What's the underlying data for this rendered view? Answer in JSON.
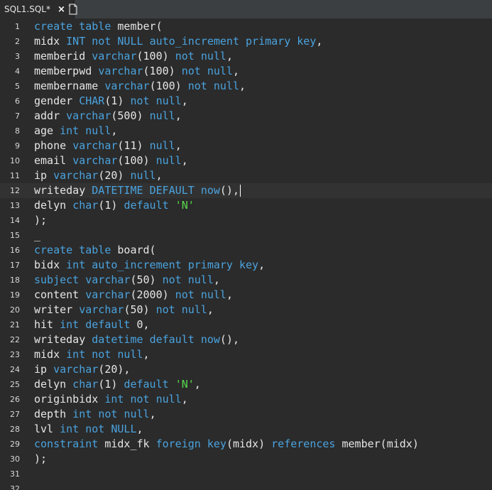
{
  "tab": {
    "title": "SQL1.SQL*",
    "close_symbol": "×"
  },
  "icons": {
    "new_tab": "new-document-icon"
  },
  "colors": {
    "background": "#2b2b2b",
    "keyword": "#4aa3df",
    "string": "#57d94a",
    "text": "#e6e6e6",
    "gutter": "#d8d8d8"
  },
  "editor": {
    "current_line": 12,
    "lines": [
      {
        "n": "1",
        "tokens": [
          [
            "k",
            "create"
          ],
          [
            "p",
            " "
          ],
          [
            "k",
            "table"
          ],
          [
            "p",
            " member("
          ]
        ]
      },
      {
        "n": "2",
        "tokens": [
          [
            "p",
            "midx "
          ],
          [
            "k",
            "INT"
          ],
          [
            "p",
            " "
          ],
          [
            "k",
            "not"
          ],
          [
            "p",
            " "
          ],
          [
            "k",
            "NULL"
          ],
          [
            "p",
            " "
          ],
          [
            "k",
            "auto_increment"
          ],
          [
            "p",
            " "
          ],
          [
            "k",
            "primary"
          ],
          [
            "p",
            " "
          ],
          [
            "k",
            "key"
          ],
          [
            "p",
            ","
          ]
        ]
      },
      {
        "n": "3",
        "tokens": [
          [
            "p",
            "memberid "
          ],
          [
            "k",
            "varchar"
          ],
          [
            "p",
            "(100) "
          ],
          [
            "k",
            "not"
          ],
          [
            "p",
            " "
          ],
          [
            "k",
            "null"
          ],
          [
            "p",
            ","
          ]
        ]
      },
      {
        "n": "4",
        "tokens": [
          [
            "p",
            "memberpwd "
          ],
          [
            "k",
            "varchar"
          ],
          [
            "p",
            "(100) "
          ],
          [
            "k",
            "not"
          ],
          [
            "p",
            " "
          ],
          [
            "k",
            "null"
          ],
          [
            "p",
            ","
          ]
        ]
      },
      {
        "n": "5",
        "tokens": [
          [
            "p",
            "membername "
          ],
          [
            "k",
            "varchar"
          ],
          [
            "p",
            "(100) "
          ],
          [
            "k",
            "not"
          ],
          [
            "p",
            " "
          ],
          [
            "k",
            "null"
          ],
          [
            "p",
            ","
          ]
        ]
      },
      {
        "n": "6",
        "tokens": [
          [
            "p",
            "gender "
          ],
          [
            "k",
            "CHAR"
          ],
          [
            "p",
            "(1) "
          ],
          [
            "k",
            "not"
          ],
          [
            "p",
            " "
          ],
          [
            "k",
            "null"
          ],
          [
            "p",
            ","
          ]
        ]
      },
      {
        "n": "7",
        "tokens": [
          [
            "p",
            "addr "
          ],
          [
            "k",
            "varchar"
          ],
          [
            "p",
            "(500) "
          ],
          [
            "k",
            "null"
          ],
          [
            "p",
            ","
          ]
        ]
      },
      {
        "n": "8",
        "tokens": [
          [
            "p",
            "age "
          ],
          [
            "k",
            "int"
          ],
          [
            "p",
            " "
          ],
          [
            "k",
            "null"
          ],
          [
            "p",
            ","
          ]
        ]
      },
      {
        "n": "9",
        "tokens": [
          [
            "p",
            "phone "
          ],
          [
            "k",
            "varchar"
          ],
          [
            "p",
            "(11) "
          ],
          [
            "k",
            "null"
          ],
          [
            "p",
            ","
          ]
        ]
      },
      {
        "n": "10",
        "tokens": [
          [
            "p",
            "email "
          ],
          [
            "k",
            "varchar"
          ],
          [
            "p",
            "(100) "
          ],
          [
            "k",
            "null"
          ],
          [
            "p",
            ","
          ]
        ]
      },
      {
        "n": "11",
        "tokens": [
          [
            "p",
            "ip "
          ],
          [
            "k",
            "varchar"
          ],
          [
            "p",
            "(20) "
          ],
          [
            "k",
            "null"
          ],
          [
            "p",
            ","
          ]
        ]
      },
      {
        "n": "12",
        "tokens": [
          [
            "p",
            "writeday "
          ],
          [
            "k",
            "DATETIME"
          ],
          [
            "p",
            " "
          ],
          [
            "k",
            "DEFAULT"
          ],
          [
            "p",
            " "
          ],
          [
            "k",
            "now"
          ],
          [
            "p",
            "(),"
          ]
        ]
      },
      {
        "n": "13",
        "tokens": [
          [
            "p",
            "delyn "
          ],
          [
            "k",
            "char"
          ],
          [
            "p",
            "(1) "
          ],
          [
            "k",
            "default"
          ],
          [
            "p",
            " "
          ],
          [
            "s",
            "'N'"
          ]
        ]
      },
      {
        "n": "14",
        "tokens": [
          [
            "p",
            ");"
          ]
        ]
      },
      {
        "n": "15",
        "tokens": [
          [
            "p",
            "_"
          ]
        ]
      },
      {
        "n": "16",
        "tokens": [
          [
            "k",
            "create"
          ],
          [
            "p",
            " "
          ],
          [
            "k",
            "table"
          ],
          [
            "p",
            " board("
          ]
        ]
      },
      {
        "n": "17",
        "tokens": [
          [
            "p",
            "bidx "
          ],
          [
            "k",
            "int"
          ],
          [
            "p",
            " "
          ],
          [
            "k",
            "auto_increment"
          ],
          [
            "p",
            " "
          ],
          [
            "k",
            "primary"
          ],
          [
            "p",
            " "
          ],
          [
            "k",
            "key"
          ],
          [
            "p",
            ","
          ]
        ]
      },
      {
        "n": "18",
        "tokens": [
          [
            "k",
            "subject"
          ],
          [
            "p",
            " "
          ],
          [
            "k",
            "varchar"
          ],
          [
            "p",
            "(50) "
          ],
          [
            "k",
            "not"
          ],
          [
            "p",
            " "
          ],
          [
            "k",
            "null"
          ],
          [
            "p",
            ","
          ]
        ]
      },
      {
        "n": "19",
        "tokens": [
          [
            "p",
            "content "
          ],
          [
            "k",
            "varchar"
          ],
          [
            "p",
            "(2000) "
          ],
          [
            "k",
            "not"
          ],
          [
            "p",
            " "
          ],
          [
            "k",
            "null"
          ],
          [
            "p",
            ","
          ]
        ]
      },
      {
        "n": "20",
        "tokens": [
          [
            "p",
            "writer "
          ],
          [
            "k",
            "varchar"
          ],
          [
            "p",
            "(50) "
          ],
          [
            "k",
            "not"
          ],
          [
            "p",
            " "
          ],
          [
            "k",
            "null"
          ],
          [
            "p",
            ","
          ]
        ]
      },
      {
        "n": "21",
        "tokens": [
          [
            "p",
            "hit "
          ],
          [
            "k",
            "int"
          ],
          [
            "p",
            " "
          ],
          [
            "k",
            "default"
          ],
          [
            "p",
            " 0,"
          ]
        ]
      },
      {
        "n": "22",
        "tokens": [
          [
            "p",
            "writeday "
          ],
          [
            "k",
            "datetime"
          ],
          [
            "p",
            " "
          ],
          [
            "k",
            "default"
          ],
          [
            "p",
            " "
          ],
          [
            "k",
            "now"
          ],
          [
            "p",
            "(),"
          ]
        ]
      },
      {
        "n": "23",
        "tokens": [
          [
            "p",
            "midx "
          ],
          [
            "k",
            "int"
          ],
          [
            "p",
            " "
          ],
          [
            "k",
            "not"
          ],
          [
            "p",
            " "
          ],
          [
            "k",
            "null"
          ],
          [
            "p",
            ","
          ]
        ]
      },
      {
        "n": "24",
        "tokens": [
          [
            "p",
            "ip "
          ],
          [
            "k",
            "varchar"
          ],
          [
            "p",
            "(20),"
          ]
        ]
      },
      {
        "n": "25",
        "tokens": [
          [
            "p",
            "delyn "
          ],
          [
            "k",
            "char"
          ],
          [
            "p",
            "(1) "
          ],
          [
            "k",
            "default"
          ],
          [
            "p",
            " "
          ],
          [
            "s",
            "'N'"
          ],
          [
            "p",
            ","
          ]
        ]
      },
      {
        "n": "26",
        "tokens": [
          [
            "p",
            "originbidx "
          ],
          [
            "k",
            "int"
          ],
          [
            "p",
            " "
          ],
          [
            "k",
            "not"
          ],
          [
            "p",
            " "
          ],
          [
            "k",
            "null"
          ],
          [
            "p",
            ","
          ]
        ]
      },
      {
        "n": "27",
        "tokens": [
          [
            "p",
            "depth "
          ],
          [
            "k",
            "int"
          ],
          [
            "p",
            " "
          ],
          [
            "k",
            "not"
          ],
          [
            "p",
            " "
          ],
          [
            "k",
            "null"
          ],
          [
            "p",
            ","
          ]
        ]
      },
      {
        "n": "28",
        "tokens": [
          [
            "p",
            "lvl "
          ],
          [
            "k",
            "int"
          ],
          [
            "p",
            " "
          ],
          [
            "k",
            "not"
          ],
          [
            "p",
            " "
          ],
          [
            "k",
            "NULL"
          ],
          [
            "p",
            ","
          ]
        ]
      },
      {
        "n": "29",
        "tokens": [
          [
            "k",
            "constraint"
          ],
          [
            "p",
            " midx_fk "
          ],
          [
            "k",
            "foreign"
          ],
          [
            "p",
            " "
          ],
          [
            "k",
            "key"
          ],
          [
            "p",
            "(midx) "
          ],
          [
            "k",
            "references"
          ],
          [
            "p",
            " member(midx)"
          ]
        ]
      },
      {
        "n": "30",
        "tokens": [
          [
            "p",
            ");"
          ]
        ]
      },
      {
        "n": "31",
        "tokens": []
      },
      {
        "n": "32",
        "tokens": []
      }
    ]
  }
}
